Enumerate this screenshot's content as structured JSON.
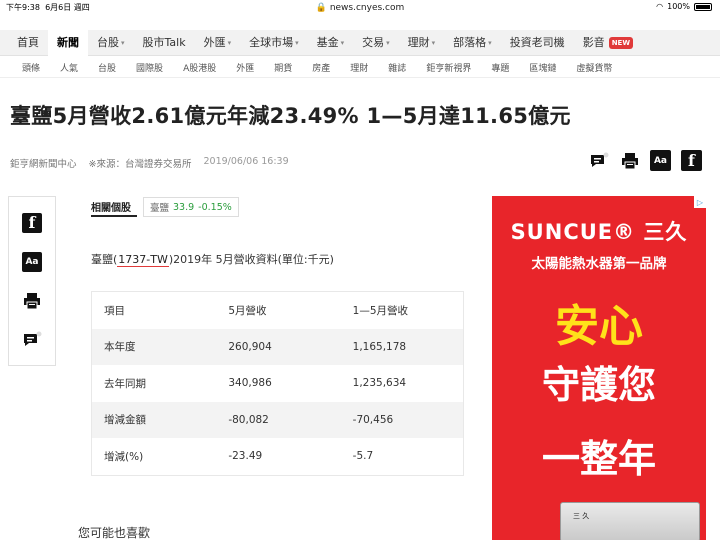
{
  "status": {
    "time": "下午9:38",
    "date": "6月6日 週四",
    "url": "news.cnyes.com",
    "battery": "100%"
  },
  "main_nav": [
    {
      "label": "首頁",
      "caret": false
    },
    {
      "label": "新聞",
      "caret": false,
      "active": true
    },
    {
      "label": "台股",
      "caret": true
    },
    {
      "label": "股市Talk",
      "caret": false
    },
    {
      "label": "外匯",
      "caret": true
    },
    {
      "label": "全球市場",
      "caret": true
    },
    {
      "label": "基金",
      "caret": true
    },
    {
      "label": "交易",
      "caret": true
    },
    {
      "label": "理財",
      "caret": true
    },
    {
      "label": "部落格",
      "caret": true
    },
    {
      "label": "投資老司機",
      "caret": false
    },
    {
      "label": "影音",
      "caret": false,
      "badge": "NEW"
    }
  ],
  "sub_nav": [
    "頭條",
    "人氣",
    "台股",
    "國際股",
    "A股港股",
    "外匯",
    "期貨",
    "房產",
    "理財",
    "雜誌",
    "鉅亨新視界",
    "專題",
    "區塊鏈",
    "虛擬貨幣"
  ],
  "article": {
    "title": "臺鹽5月營收2.61億元年減23.49% 1—5月達11.65億元",
    "author": "鉅亨網新聞中心",
    "source": "※來源：台灣證券交易所",
    "datetime": "2019/06/06 16:39",
    "related_label": "相關個股",
    "stock": {
      "name": "臺鹽",
      "price": "33.9",
      "change": "-0.15%"
    },
    "intro_prefix": "臺鹽(",
    "intro_code": "1737-TW",
    "intro_suffix": ")2019年 5月營收資料(單位:千元)",
    "table": {
      "headers": [
        "項目",
        "5月營收",
        "1—5月營收"
      ],
      "rows": [
        [
          "本年度",
          "260,904",
          "1,165,178"
        ],
        [
          "去年同期",
          "340,986",
          "1,235,634"
        ],
        [
          "增減金額",
          "-80,082",
          "-70,456"
        ],
        [
          "增減(%)",
          "-23.49",
          "-5.7"
        ]
      ]
    },
    "recommend_label": "您可能也喜歡"
  },
  "icons": {
    "aa_label": "Aa",
    "fb_label": "f"
  },
  "ad": {
    "brand": "SUNCUE® 三久",
    "tagline": "太陽能熱水器第一品牌",
    "line1": "安心",
    "line2": "守護您",
    "line3": "一整年",
    "product_label": "三 久",
    "colors": {
      "bg": "#e8252a",
      "highlight": "#ffe21a"
    }
  }
}
